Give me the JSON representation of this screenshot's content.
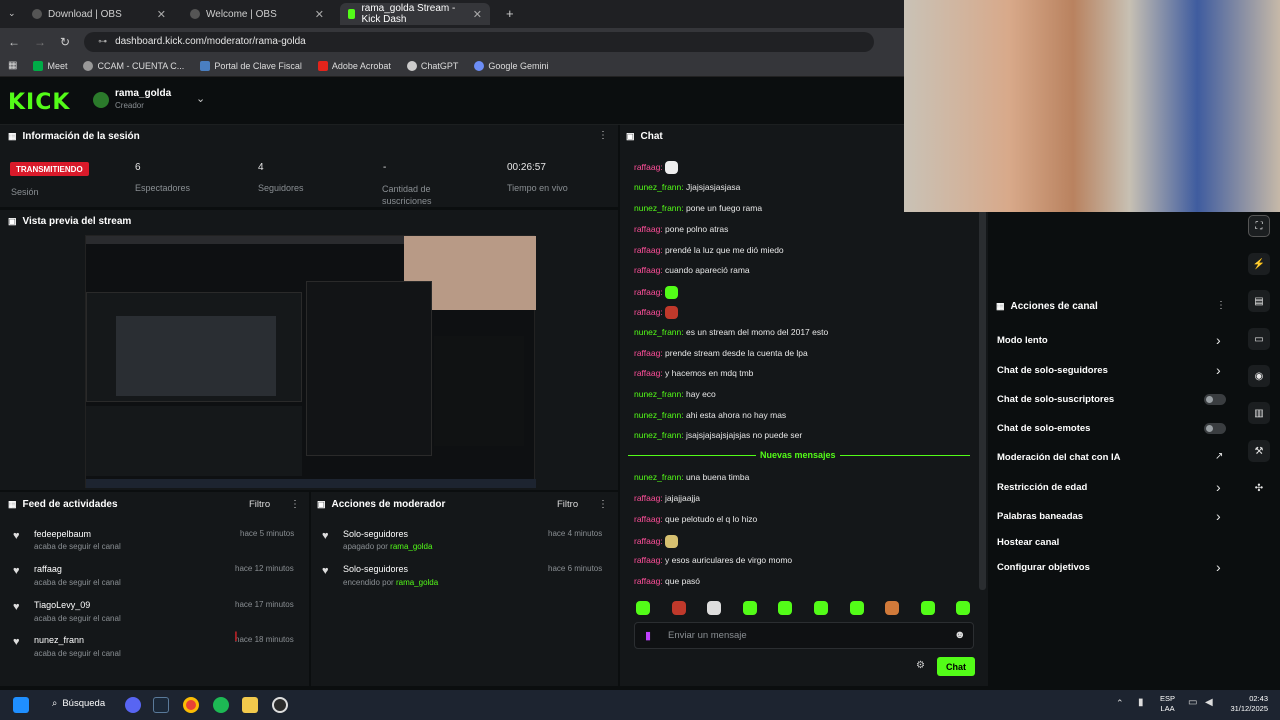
{
  "browser": {
    "tabs": [
      {
        "label": "Download | OBS"
      },
      {
        "label": "Welcome | OBS"
      },
      {
        "label": "rama_golda Stream - Kick Dash"
      }
    ],
    "url": "dashboard.kick.com/moderator/rama-golda",
    "bookmarks": [
      "Meet",
      "CCAM - CUENTA C...",
      "Portal de Clave Fiscal",
      "Adobe Acrobat",
      "ChatGPT",
      "Google Gemini"
    ]
  },
  "header": {
    "logo": "KICK",
    "channel_name": "rama_golda",
    "channel_role": "Creador"
  },
  "session": {
    "title": "Información de la sesión",
    "status_badge": "TRANSMITIENDO",
    "status_label": "Sesión",
    "stats": [
      {
        "value": "6",
        "label": "Espectadores"
      },
      {
        "value": "4",
        "label": "Seguidores"
      },
      {
        "value": "-",
        "label": "Cantidad de suscriciones"
      },
      {
        "value": "00:26:57",
        "label": "Tiempo en vivo"
      }
    ]
  },
  "preview": {
    "title": "Vista previa del stream"
  },
  "activity_feed": {
    "title": "Feed de actividades",
    "filter": "Filtro",
    "items": [
      {
        "user": "fedeepelbaum",
        "action": "acaba de seguir el canal",
        "time": "hace 5 minutos"
      },
      {
        "user": "raffaag",
        "action": "acaba de seguir el canal",
        "time": "hace 12 minutos"
      },
      {
        "user": "TiagoLevy_09",
        "action": "acaba de seguir el canal",
        "time": "hace 17 minutos"
      },
      {
        "user": "nunez_frann",
        "action": "acaba de seguir el canal",
        "time": "hace 18 minutos"
      }
    ]
  },
  "mod_actions": {
    "title": "Acciones de moderador",
    "filter": "Filtro",
    "items": [
      {
        "title": "Solo-seguidores",
        "desc": "apagado por",
        "by": "rama_golda",
        "time": "hace 4 minutos"
      },
      {
        "title": "Solo-seguidores",
        "desc": "encendido por",
        "by": "rama_golda",
        "time": "hace 6 minutos"
      }
    ]
  },
  "chat": {
    "title": "Chat",
    "messages": [
      {
        "user": "raffaag",
        "text": "",
        "color": "#ff4f9a"
      },
      {
        "user": "nunez_frann",
        "text": "Jjajsjasjasjasa",
        "color": "#53fc18"
      },
      {
        "user": "nunez_frann",
        "text": "pone un fuego rama",
        "color": "#53fc18"
      },
      {
        "user": "raffaag",
        "text": "pone polno atras",
        "color": "#ff4f9a"
      },
      {
        "user": "raffaag",
        "text": "prendé la luz que me dió miedo",
        "color": "#ff4f9a"
      },
      {
        "user": "raffaag",
        "text": "cuando apareció rama",
        "color": "#ff4f9a"
      },
      {
        "user": "raffaag",
        "text": "",
        "color": "#ff4f9a"
      },
      {
        "user": "raffaag",
        "text": "",
        "color": "#ff4f9a"
      },
      {
        "user": "nunez_frann",
        "text": "es un stream del momo del 2017 esto",
        "color": "#53fc18"
      },
      {
        "user": "raffaag",
        "text": "prende stream desde la cuenta de lpa",
        "color": "#ff4f9a"
      },
      {
        "user": "raffaag",
        "text": "y hacemos en mdq tmb",
        "color": "#ff4f9a"
      },
      {
        "user": "nunez_frann",
        "text": "hay eco",
        "color": "#53fc18"
      },
      {
        "user": "nunez_frann",
        "text": "ahi esta ahora no hay mas",
        "color": "#53fc18"
      },
      {
        "user": "nunez_frann",
        "text": "jsajsjajsajsjajsjas no puede ser",
        "color": "#53fc18"
      }
    ],
    "new_messages_label": "Nuevas mensajes",
    "new_messages": [
      {
        "user": "nunez_frann",
        "text": "una buena timba",
        "color": "#53fc18"
      },
      {
        "user": "raffaag",
        "text": "jajajjaajja",
        "color": "#ff4f9a"
      },
      {
        "user": "raffaag",
        "text": "que pelotudo el q lo hizo",
        "color": "#ff4f9a"
      },
      {
        "user": "raffaag",
        "text": "",
        "color": "#ff4f9a"
      },
      {
        "user": "raffaag",
        "text": "y esos auriculares de virgo momo",
        "color": "#ff4f9a"
      },
      {
        "user": "raffaag",
        "text": "que pasó",
        "color": "#ff4f9a"
      }
    ],
    "input_placeholder": "Enviar un mensaje",
    "send_label": "Chat"
  },
  "channel_actions": {
    "title": "Acciones de canal",
    "items": [
      {
        "label": "Modo lento",
        "kind": "chevron"
      },
      {
        "label": "Chat de solo-seguidores",
        "kind": "chevron"
      },
      {
        "label": "Chat de solo-suscriptores",
        "kind": "toggle"
      },
      {
        "label": "Chat de solo-emotes",
        "kind": "toggle"
      },
      {
        "label": "Moderación del chat con IA",
        "kind": "external"
      },
      {
        "label": "Restricción de edad",
        "kind": "chevron"
      },
      {
        "label": "Palabras baneadas",
        "kind": "chevron"
      },
      {
        "label": "Hostear canal",
        "kind": "none"
      },
      {
        "label": "Configurar objetivos",
        "kind": "chevron"
      }
    ]
  },
  "taskbar": {
    "search_label": "Búsqueda",
    "lang": "ESP",
    "lang2": "LAA",
    "time": "02:43",
    "date": "31/12/2025"
  }
}
